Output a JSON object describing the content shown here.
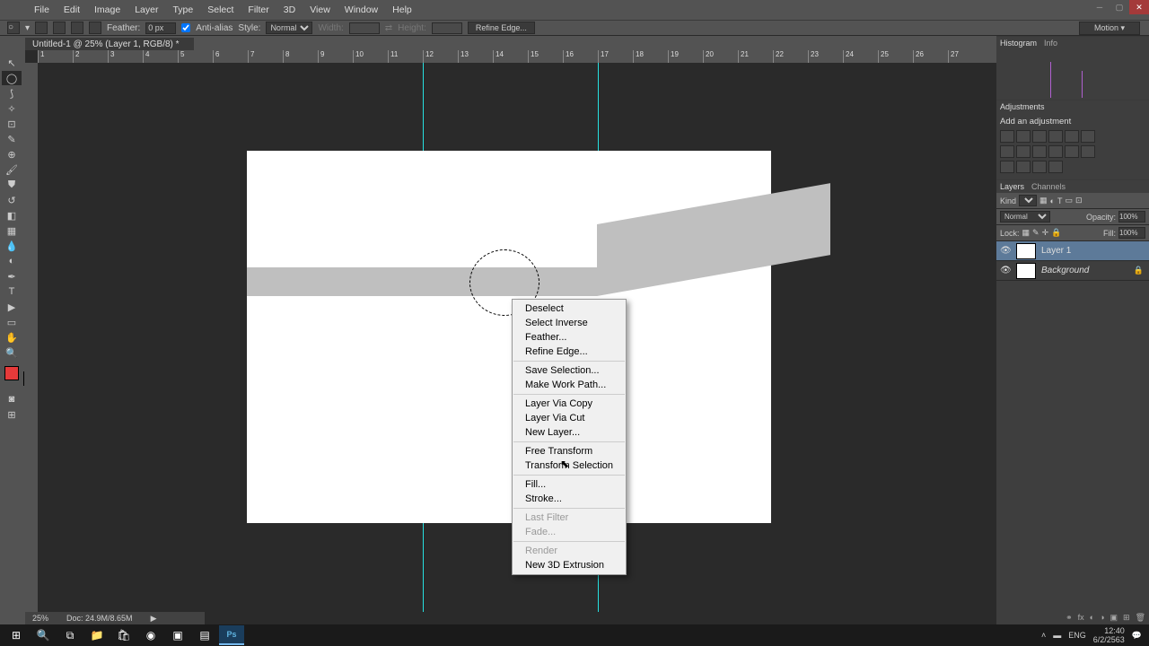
{
  "app": {
    "name": "Ps"
  },
  "menu": [
    "File",
    "Edit",
    "Image",
    "Layer",
    "Type",
    "Select",
    "Filter",
    "3D",
    "View",
    "Window",
    "Help"
  ],
  "optbar": {
    "feather_label": "Feather:",
    "feather_val": "0 px",
    "aa_label": "Anti-alias",
    "style_label": "Style:",
    "style_val": "Normal",
    "width_label": "Width:",
    "height_label": "Height:",
    "refine": "Refine Edge...",
    "motion": "Motion"
  },
  "doc_tab": "Untitled-1 @ 25% (Layer 1, RGB/8) *",
  "ruler_ticks": [
    "1",
    "2",
    "3",
    "4",
    "5",
    "6",
    "7",
    "8",
    "9",
    "10",
    "11",
    "12",
    "13",
    "14",
    "15",
    "16",
    "17",
    "18",
    "19",
    "20",
    "21",
    "22",
    "23",
    "24",
    "25",
    "26",
    "27"
  ],
  "context_menu": [
    {
      "label": "Deselect",
      "en": true
    },
    {
      "label": "Select Inverse",
      "en": true
    },
    {
      "label": "Feather...",
      "en": true
    },
    {
      "label": "Refine Edge...",
      "en": true
    },
    {
      "sep": true
    },
    {
      "label": "Save Selection...",
      "en": true
    },
    {
      "label": "Make Work Path...",
      "en": true
    },
    {
      "sep": true
    },
    {
      "label": "Layer Via Copy",
      "en": true
    },
    {
      "label": "Layer Via Cut",
      "en": true
    },
    {
      "label": "New Layer...",
      "en": true
    },
    {
      "sep": true
    },
    {
      "label": "Free Transform",
      "en": true
    },
    {
      "label": "Transform Selection",
      "en": true
    },
    {
      "sep": true
    },
    {
      "label": "Fill...",
      "en": true
    },
    {
      "label": "Stroke...",
      "en": true
    },
    {
      "sep": true
    },
    {
      "label": "Last Filter",
      "en": false
    },
    {
      "label": "Fade...",
      "en": false
    },
    {
      "sep": true
    },
    {
      "label": "Render",
      "en": false
    },
    {
      "label": "New 3D Extrusion",
      "en": true
    }
  ],
  "panels": {
    "hist_tab": "Histogram",
    "info_tab": "Info",
    "adj_tab": "Adjustments",
    "adj_title": "Add an adjustment",
    "layers_tab": "Layers",
    "channels_tab": "Channels",
    "kind_label": "Kind",
    "blend": "Normal",
    "opacity_label": "Opacity:",
    "opacity_val": "100%",
    "lock_label": "Lock:",
    "fill_label": "Fill:",
    "fill_val": "100%",
    "layers": [
      {
        "name": "Layer 1",
        "locked": false
      },
      {
        "name": "Background",
        "locked": true
      }
    ]
  },
  "status": {
    "zoom": "25%",
    "docsize": "Doc: 24.9M/8.65M"
  },
  "tray": {
    "lang": "ENG",
    "time": "12:40",
    "date": "6/2/2563"
  },
  "tools": [
    "move",
    "marquee",
    "lasso",
    "wand",
    "crop",
    "eyedrop",
    "heal",
    "brush",
    "stamp",
    "history",
    "eraser",
    "gradient",
    "blur",
    "dodge",
    "pen",
    "type",
    "path",
    "shape",
    "hand",
    "zoom"
  ]
}
